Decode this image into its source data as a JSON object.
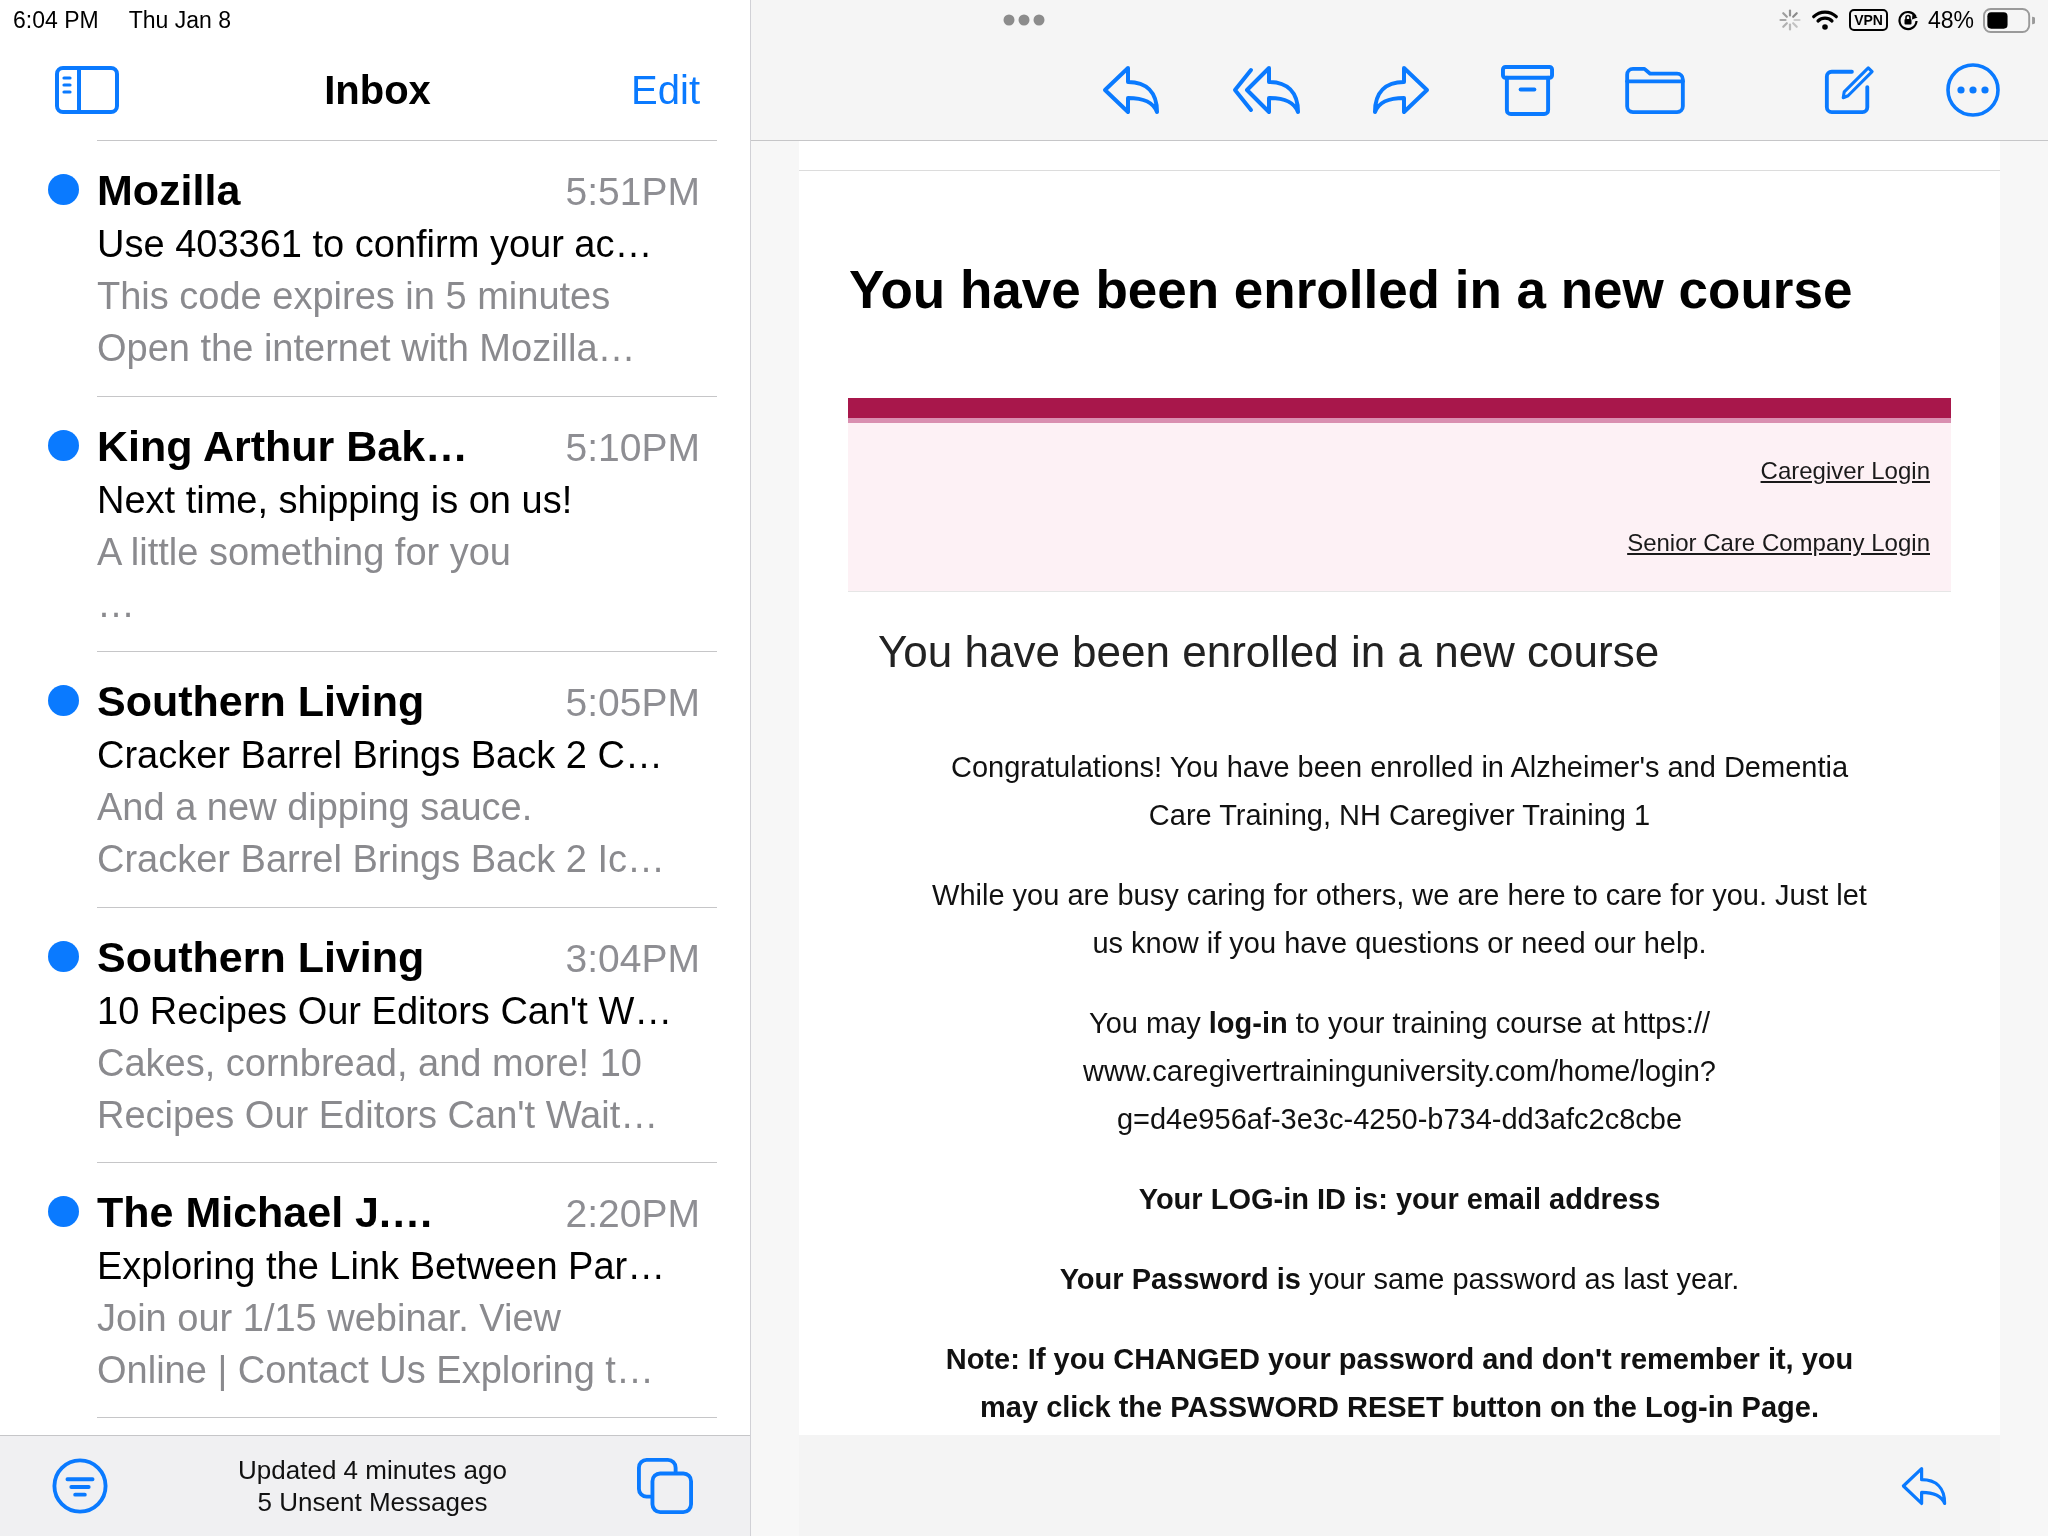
{
  "status_bar": {
    "time": "6:04 PM",
    "date": "Thu Jan 8",
    "vpn_label": "VPN",
    "battery_percent": "48%"
  },
  "mailbox": {
    "title": "Inbox",
    "edit_label": "Edit"
  },
  "messages": [
    {
      "sender": "Mozilla",
      "time": "5:51PM",
      "subject": "Use 403361 to confirm your ac…",
      "preview": "This code expires in 5 minutes\nOpen the internet with Mozilla…",
      "unread": true
    },
    {
      "sender": "King Arthur Bak…",
      "time": "5:10PM",
      "subject": "Next time, shipping is on us!",
      "preview": "A little something for you\n…",
      "unread": true
    },
    {
      "sender": "Southern Living",
      "time": "5:05PM",
      "subject": "Cracker Barrel Brings Back 2 C…",
      "preview": "And a new dipping sauce.\nCracker Barrel Brings Back 2 Ic…",
      "unread": true
    },
    {
      "sender": "Southern Living",
      "time": "3:04PM",
      "subject": "10 Recipes Our Editors Can't W…",
      "preview": "Cakes, cornbread, and more! 10\nRecipes Our Editors Can't Wait…",
      "unread": true
    },
    {
      "sender": "The Michael J.…",
      "time": "2:20PM",
      "subject": "Exploring the Link Between Par…",
      "preview": "Join our 1/15 webinar. View\nOnline | Contact Us Exploring t…",
      "unread": true
    }
  ],
  "mailbox_footer": {
    "updated": "Updated 4 minutes ago",
    "unsent": "5 Unsent Messages"
  },
  "message_view": {
    "title": "You have been enrolled in a new course",
    "banner_links": [
      "Caregiver Login",
      "Senior Care Company Login"
    ],
    "heading": "You have been enrolled in a new course",
    "paragraphs": [
      {
        "text": "Congratulations! You have been enrolled in Alzheimer's and Dementia\nCare Training, NH Caregiver Training 1",
        "bold": false
      },
      {
        "text": "While you are busy caring for others, we are here to care for you. Just let\nus know if you have questions or need our help.",
        "bold": false
      },
      {
        "text": "You may **log-in** to your training course at https://\nwww.caregivertraininguniversity.com/home/login?\ng=d4e956af-3e3c-4250-b734-dd3afc2c8cbe",
        "bold": false
      },
      {
        "text": "Your LOG-in ID is: your email address",
        "bold": true
      },
      {
        "text": "**Your Password is** your same password as last year.",
        "bold": false
      },
      {
        "text": "Note: If you CHANGED your password and don't remember it, you\nmay click the PASSWORD RESET button on the Log-in Page.",
        "bold": true
      }
    ]
  }
}
